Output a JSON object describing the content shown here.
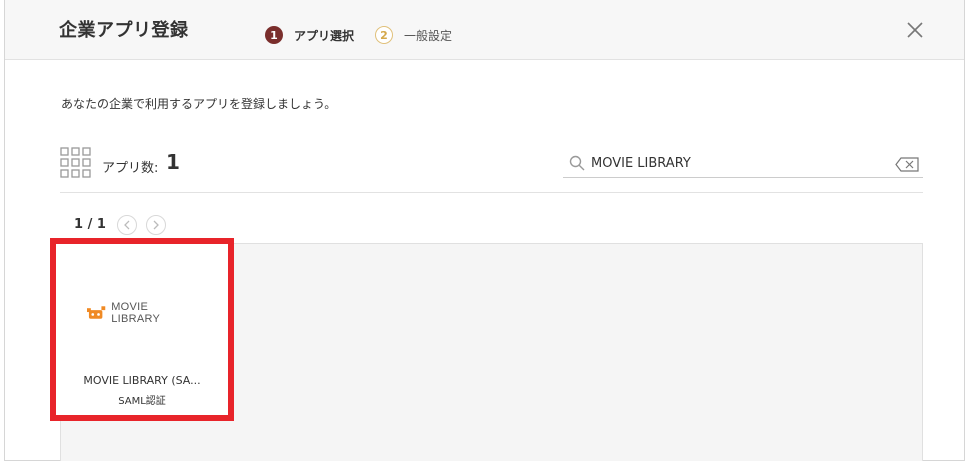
{
  "header": {
    "title": "企業アプリ登録",
    "steps": [
      {
        "number": "1",
        "label": "アプリ選択"
      },
      {
        "number": "2",
        "label": "一般設定"
      }
    ]
  },
  "intro": "あなたの企業で利用するアプリを登録しましょう。",
  "summary": {
    "label": "アプリ数:",
    "count": "1"
  },
  "search": {
    "value": "MOVIE LIBRARY"
  },
  "pager": {
    "text": "1 / 1"
  },
  "apps": [
    {
      "logo_text": "MOVIE LIBRARY",
      "name": "MOVIE LIBRARY (SA...",
      "type": "SAML認証"
    }
  ],
  "colors": {
    "active_step": "#7a2e2c",
    "inactive_step": "#d4a84b",
    "selection_border": "#e8242a",
    "logo_orange": "#f08a24"
  }
}
